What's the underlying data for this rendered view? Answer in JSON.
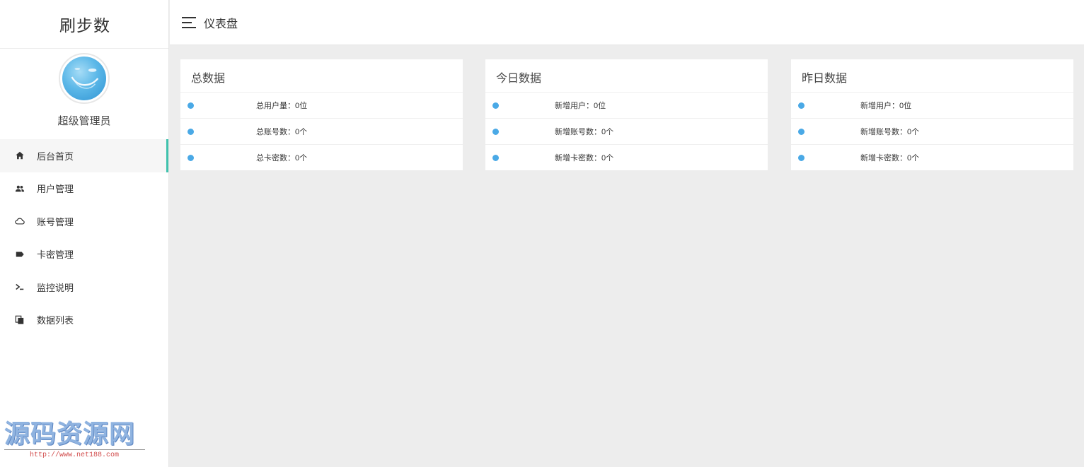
{
  "brand": {
    "title": "刷步数"
  },
  "profile": {
    "role": "超级管理员"
  },
  "nav": [
    {
      "label": "后台首页",
      "icon": "home-icon",
      "active": true
    },
    {
      "label": "用户管理",
      "icon": "users-icon",
      "active": false
    },
    {
      "label": "账号管理",
      "icon": "cloud-icon",
      "active": false
    },
    {
      "label": "卡密管理",
      "icon": "tag-icon",
      "active": false
    },
    {
      "label": "监控说明",
      "icon": "terminal-icon",
      "active": false
    },
    {
      "label": "数据列表",
      "icon": "copy-icon",
      "active": false
    }
  ],
  "header": {
    "title": "仪表盘"
  },
  "cards": [
    {
      "title": "总数据",
      "rows": [
        "总用户量：0位",
        "总账号数：0个",
        "总卡密数：0个"
      ]
    },
    {
      "title": "今日数据",
      "rows": [
        "新增用户：0位",
        "新增账号数：0个",
        "新增卡密数：0个"
      ]
    },
    {
      "title": "昨日数据",
      "rows": [
        "新增用户：0位",
        "新增账号数：0个",
        "新增卡密数：0个"
      ]
    }
  ],
  "watermark": {
    "text": "源码资源网",
    "url": "http://www.net188.com"
  },
  "colors": {
    "accent": "#3fc2ad",
    "dot": "#4aa9e6",
    "background": "#ededed"
  }
}
